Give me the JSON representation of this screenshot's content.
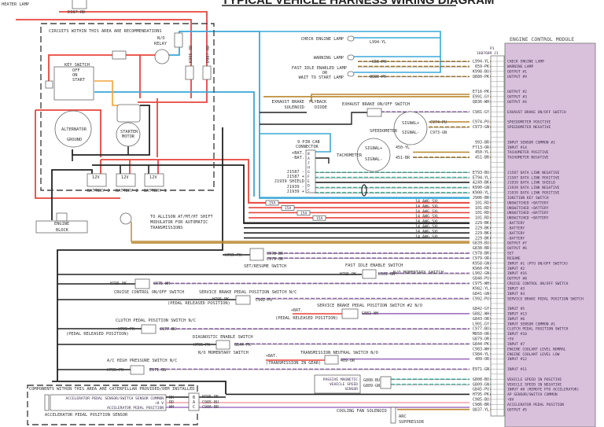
{
  "title": "TYPICAL VEHICLE HARNESS WIRING DIAGRAM",
  "top_left": {
    "heater_lamp": "HEATER LAMP",
    "wire": "D987-RD"
  },
  "recommend_area": {
    "caption": "CIRCUITS WITHIN THIS AREA ARE RECOMMENDATIONS",
    "relay": [
      "N/O",
      "RELAY"
    ],
    "wire_a": "K995-OD",
    "wire_b": "D987-RD",
    "key_switch": {
      "title": "KEY SWITCH",
      "positions": [
        "OFF",
        "ON",
        "START"
      ]
    },
    "alternator": [
      "ALTERNATOR",
      "GROUND"
    ],
    "starter": [
      "STARTER",
      "MOTOR"
    ],
    "batteries": [
      {
        "label": "BATTERY 3",
        "volts": "12V"
      },
      {
        "label": "BATTERY 2",
        "volts": "12V"
      },
      {
        "label": "BATTERY 1",
        "volts": "12V"
      }
    ]
  },
  "engine_block": [
    "ENGINE",
    "BLOCK"
  ],
  "allison_note": [
    "TO ALLISON AT/MT/HT SHIFT",
    "MODULATOR FOR AUTOMATIC",
    "TRANSMISSIONS"
  ],
  "lamps": [
    {
      "label": [
        "CHECK ENGINE LAMP"
      ],
      "wire": "L994-YL"
    },
    {
      "label": [
        "WARNING LAMP"
      ],
      "wire": "659-PK"
    },
    {
      "label": [
        "FAST IDLE ENABLED LAMP",
        "OR",
        "WAIT TO START LAMP"
      ],
      "wire": "Q880-PK"
    }
  ],
  "exhaust": {
    "solenoid": [
      "EXHAUST BRAKE",
      "SOLENOID"
    ],
    "diode": [
      "FLYBACK",
      "DIODE"
    ],
    "switch": "EXHAUST BRAKE ON/OFF SWITCH"
  },
  "speedometer": {
    "label": "SPEEDOMETER",
    "pins": [
      "SIGNAL+",
      "SIGNAL-"
    ],
    "wires": [
      "C974-PU",
      "C973-GN"
    ]
  },
  "tachometer": {
    "label": "TACHOMETER",
    "pins": [
      "SIGNAL+",
      "SIGNAL-"
    ],
    "wires": [
      "450-YL",
      "451-BR"
    ]
  },
  "cab_connector": {
    "title": [
      "9 PIN CAB",
      "CONNECTOR"
    ],
    "labels": [
      "+BAT.",
      "-BAT.",
      "J1587 -",
      "J1587 +",
      "J1939 SHIELD",
      "J1939 -",
      "J1939 +"
    ],
    "pins": [
      "B",
      "A",
      "J",
      "H",
      "G",
      "F",
      "E",
      "D",
      "C"
    ]
  },
  "power_feeds": {
    "fuse": "15A",
    "wire_label": "14 AWG SXL",
    "count": 8
  },
  "switches": {
    "set_resume": {
      "label": "SET/RESUME SWITCH",
      "in": "H795-PK",
      "out": [
        "C978-BR",
        "C979-OR"
      ]
    },
    "fast_idle": {
      "label": "FAST IDLE ENABLE SWITCH",
      "in": "H795-PK",
      "out": "L902-GN",
      "note": "N/O MOMENTARY SWITCH"
    },
    "cruise": {
      "label": "CRUISE CONTROL ON/OFF SWITCH",
      "in": "H795-PK",
      "out": "C975-WH"
    },
    "service_brake": {
      "label": "SERVICE BRAKE PEDAL POSITION SWITCH N/C",
      "in": "H795-PK",
      "out": "C992-PU",
      "note": "(PEDAL RELEASED POSITION)"
    },
    "service_brake2": {
      "label": "SERVICE BRAKE PEDAL POSITION SWITCH #2 N/O",
      "in": "+BAT.",
      "out": "G882-WH",
      "note": "(PEDAL RELEASED POSITION)"
    },
    "clutch": {
      "label": "CLUTCH PEDAL POSITION SWITCH N/C",
      "in": "H795-PK",
      "out": "C977-BU",
      "note": "(PEDAL RELEASED POSITION)"
    },
    "diagnostic": {
      "label": "DIAGNOSTIC ENABLE SWITCH",
      "in": "H795-PK",
      "out": "G844-PK",
      "note": "N/O MOMENTARY SWITCH"
    },
    "trans_neutral": {
      "label": "TRANSMISSION NEUTRAL SWITCH N/O",
      "in": "+BAT.",
      "out": "409-OR",
      "note": "(TRANSMISSION IN GEAR)"
    },
    "ac_pressure": {
      "label": "A/C HIGH PRESSURE SWITCH N/C",
      "in": "H795-PK",
      "out": "E971-GN"
    }
  },
  "cat_area": {
    "caption": "COMPONENTS WITHIN THIS AREA ARE CATERPILLAR PROVIDED/OEM INSTALLED",
    "sensor_label": "ACCELERATOR PEDAL POSITION SENSOR",
    "lines": [
      "ACCELERATOR PEDAL SENSOR/SWITCH SENSOR COMMON",
      "+8 V",
      "ACCELERATOR PEDAL POSITION"
    ],
    "colors": [
      "BK",
      "RD",
      "WH"
    ],
    "pins": [
      "B",
      "A",
      "C"
    ],
    "wires": [
      "H795-PK",
      "C985-BU",
      "C986-BR"
    ]
  },
  "vss": {
    "label": [
      "PASSIVE MAGNETIC",
      "VEHICLE SPEED",
      "SENSOR"
    ],
    "wires": [
      "G808-BU",
      "G809-GN"
    ]
  },
  "cooling_fan": {
    "label": "COOLING FAN SOLENOID",
    "suppressor": [
      "ARC",
      "SUPPRESSOR"
    ]
  },
  "ecm": {
    "title": "ENGINE CONTROL MODULE",
    "connector": [
      "P1",
      "1607689 J1"
    ],
    "pins": [
      {
        "wire": "L994-YL",
        "label": "CHECK ENGINE LAMP",
        "c": "#b8862b",
        "d": 1
      },
      {
        "wire": "659-PK",
        "label": "WARNING LAMP",
        "c": "#b8862b",
        "d": 1
      },
      {
        "wire": "K998-BU",
        "label": "OUTPUT #1",
        "c": "#888",
        "d": 0
      },
      {
        "wire": "Q880-PK",
        "label": "OUTPUT #9",
        "c": "#b8862b",
        "d": 1
      },
      {
        "wire": "",
        "label": ""
      },
      {
        "wire": "",
        "label": ""
      },
      {
        "wire": "E716-PK",
        "label": "OUTPUT #2",
        "c": "#888",
        "d": 0
      },
      {
        "wire": "E991-GY",
        "label": "OUTPUT #3",
        "c": "#b8862b",
        "d": 0
      },
      {
        "wire": "Q836-WH",
        "label": "OUTPUT #4",
        "c": "#888",
        "d": 0
      },
      {
        "wire": "",
        "label": ""
      },
      {
        "wire": "C981-GY",
        "label": "EXHAUST BRAKE ON/OFF SWITCH",
        "c": "#a070c0",
        "d": 1
      },
      {
        "wire": "",
        "label": ""
      },
      {
        "wire": "C974-PU",
        "label": "SPEEDOMETER POSITIVE",
        "c": "#b8862b",
        "d": 0
      },
      {
        "wire": "C973-GN",
        "label": "SPEEDOMETER NEGATIVE",
        "c": "#b8862b",
        "d": 1
      },
      {
        "wire": "",
        "label": ""
      },
      {
        "wire": "",
        "label": ""
      },
      {
        "wire": "993-BR",
        "label": "INPUT SENSOR COMMON #2",
        "c": "#888",
        "d": 0
      },
      {
        "wire": "F713-OR",
        "label": "INPUT #14",
        "c": "#888",
        "d": 0
      },
      {
        "wire": "450-YL",
        "label": "TACHOMETER POSITIVE",
        "c": "#b8862b",
        "d": 0
      },
      {
        "wire": "451-BR",
        "label": "TACHOMETER NEGATIVE",
        "c": "#b8862b",
        "d": 1
      },
      {
        "wire": "",
        "label": ""
      },
      {
        "wire": "",
        "label": ""
      },
      {
        "wire": "E793-BU",
        "label": "J1587 DATA LINK NEGATIVE",
        "c": "#4cc3b0",
        "d": 1
      },
      {
        "wire": "E794-YL",
        "label": "J1587 DATA LINK POSITIVE",
        "c": "#4cc3b0",
        "d": 1
      },
      {
        "wire": "A249-BK",
        "label": "J1939 DATA LINK SHIELD",
        "c": "#222",
        "d": 0
      },
      {
        "wire": "K990-GN",
        "label": "J1939 DATA LINK NEGATIVE",
        "c": "#4cc3b0",
        "d": 1
      },
      {
        "wire": "K900-YL",
        "label": "J1939 DATA LINK POSITIVE",
        "c": "#4cc3b0",
        "d": 1
      },
      {
        "wire": "J906-BR",
        "label": "IGNITION KEY SWITCH",
        "c": "#3aa8d8",
        "d": 0
      },
      {
        "wire": "101-RD",
        "label": "UNSWITCHED +BATTERY",
        "c": "#e8453c",
        "d": 0
      },
      {
        "wire": "101-RD",
        "label": "UNSWITCHED +BATTERY",
        "c": "#e8453c",
        "d": 0
      },
      {
        "wire": "101-RD",
        "label": "UNSWITCHED +BATTERY",
        "c": "#e8453c",
        "d": 0
      },
      {
        "wire": "101-RD",
        "label": "UNSWITCHED +BATTERY",
        "c": "#e8453c",
        "d": 0
      },
      {
        "wire": "229-BK",
        "label": "-BATTERY",
        "c": "#222",
        "d": 0
      },
      {
        "wire": "229-BK",
        "label": "-BATTERY",
        "c": "#222",
        "d": 0
      },
      {
        "wire": "229-BK",
        "label": "-BATTERY",
        "c": "#222",
        "d": 0
      },
      {
        "wire": "229-BK",
        "label": "-BATTERY",
        "c": "#222",
        "d": 0
      },
      {
        "wire": "G839-BU",
        "label": "OUTPUT #7",
        "c": "#b8862b",
        "d": 0
      },
      {
        "wire": "G838-BR",
        "label": "OUTPUT #6",
        "c": "#888",
        "d": 0
      },
      {
        "wire": "C978-BR",
        "label": "SET",
        "c": "#a070c0",
        "d": 1
      },
      {
        "wire": "C979-OR",
        "label": "RESUME",
        "c": "#a070c0",
        "d": 1
      },
      {
        "wire": "K958-GN",
        "label": "INPUT #1  (PTO ON/OFF SWITCH)",
        "c": "#888",
        "d": 0
      },
      {
        "wire": "K960-PK",
        "label": "INPUT #2",
        "c": "#888",
        "d": 0
      },
      {
        "wire": "L902-GN",
        "label": "INPUT #16",
        "c": "#a070c0",
        "d": 1
      },
      {
        "wire": "G840-PU",
        "label": "OUTPUT #8",
        "c": "#888",
        "d": 0
      },
      {
        "wire": "C975-WH",
        "label": "CRUISE CONTROL ON/OFF SWITCH",
        "c": "#a070c0",
        "d": 1
      },
      {
        "wire": "K982-YL",
        "label": "INPUT #3",
        "c": "#888",
        "d": 0
      },
      {
        "wire": "G841-GN",
        "label": "INPUT #4",
        "c": "#888",
        "d": 0
      },
      {
        "wire": "C992-PU",
        "label": "SERVICE BRAKE PEDAL POSITION SWITCH",
        "c": "#a070c0",
        "d": 1
      },
      {
        "wire": "",
        "label": ""
      },
      {
        "wire": "G842-GY",
        "label": "INPUT #5",
        "c": "#888",
        "d": 0
      },
      {
        "wire": "G882-WH",
        "label": "INPUT #13",
        "c": "#a070c0",
        "d": 0
      },
      {
        "wire": "G843-OR",
        "label": "INPUT #6",
        "c": "#888",
        "d": 0
      },
      {
        "wire": "L901-GY",
        "label": "INPUT SENSOR COMMON #1",
        "c": "#888",
        "d": 0
      },
      {
        "wire": "C977-BU",
        "label": "CLUTCH PEDAL POSITION SWITCH",
        "c": "#a070c0",
        "d": 1
      },
      {
        "wire": "M850-OR",
        "label": "INPUT #10",
        "c": "#888",
        "d": 0
      },
      {
        "wire": "G879-OR",
        "label": "+5V",
        "c": "#888",
        "d": 0
      },
      {
        "wire": "G844-PK",
        "label": "INPUT #7",
        "c": "#a070c0",
        "d": 1
      },
      {
        "wire": "C983-WH",
        "label": "ENGINE COOLANT LEVEL NORMAL",
        "c": "#888",
        "d": 0
      },
      {
        "wire": "C984-YL",
        "label": "ENGINE COOLANT LEVEL LOW",
        "c": "#888",
        "d": 0
      },
      {
        "wire": "409-OR",
        "label": "INPUT #12",
        "c": "#a070c0",
        "d": 0
      },
      {
        "wire": "",
        "label": ""
      },
      {
        "wire": "E971-GN",
        "label": "INPUT #11",
        "c": "#a070c0",
        "d": 1
      },
      {
        "wire": "",
        "label": ""
      },
      {
        "wire": "G808-BU",
        "label": "VEHICLE SPEED IN POSITIVE",
        "c": "#4cc3b0",
        "d": 1
      },
      {
        "wire": "G809-GN",
        "label": "VEHICLE SPEED IN NEGATIVE",
        "c": "#4cc3b0",
        "d": 1
      },
      {
        "wire": "G845-PU",
        "label": "INPUT #8  (REMOTE PTO ACCELERATOR)",
        "c": "#888",
        "d": 0
      },
      {
        "wire": "H795-PK",
        "label": "AP SENSOR/SWITCH COMMON",
        "c": "#222",
        "d": 0
      },
      {
        "wire": "C985-BU",
        "label": "+8V",
        "c": "#f3a0a8",
        "d": 0
      },
      {
        "wire": "C986-BR",
        "label": "ACCELERATOR PEDAL POSITION",
        "c": "#a070c0",
        "d": 0
      },
      {
        "wire": "Q837-YL",
        "label": "OUTPUT #5",
        "c": "#b8862b",
        "d": 0
      }
    ]
  }
}
